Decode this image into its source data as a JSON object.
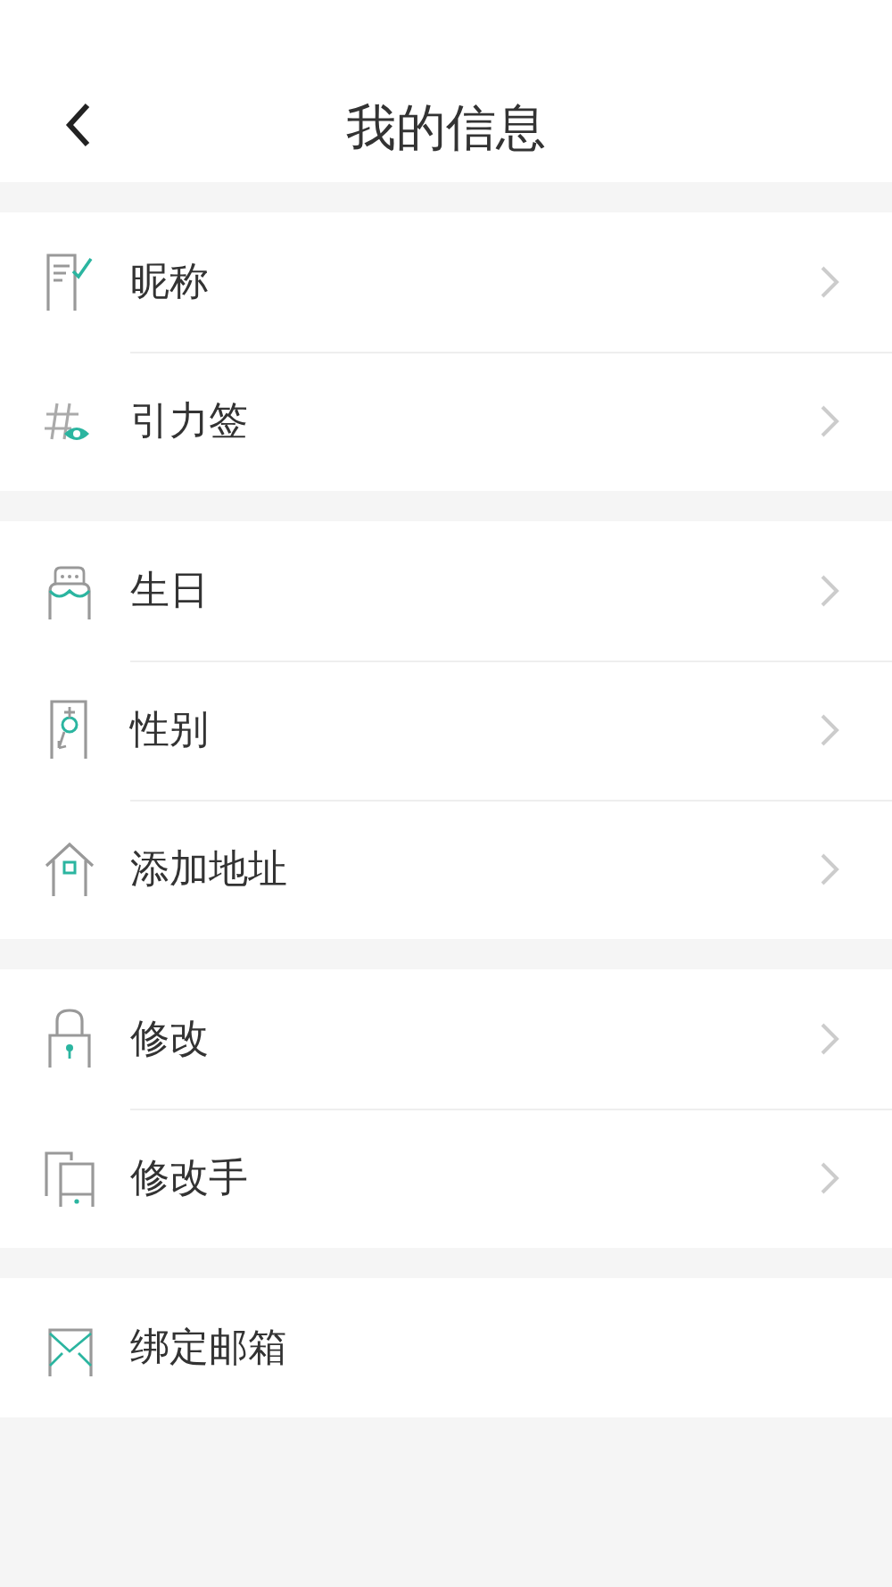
{
  "header": {
    "title": "我的信息"
  },
  "groups": [
    {
      "items": [
        {
          "kind": "nickname",
          "label": "昵称",
          "chevron": true
        },
        {
          "kind": "tag",
          "label": "引力签",
          "chevron": true
        }
      ]
    },
    {
      "items": [
        {
          "kind": "birthday",
          "label": "生日",
          "chevron": true
        },
        {
          "kind": "gender",
          "label": "性别",
          "chevron": true
        },
        {
          "kind": "address",
          "label": "添加地址",
          "chevron": true
        }
      ]
    },
    {
      "items": [
        {
          "kind": "password",
          "label": "修改",
          "chevron": true
        },
        {
          "kind": "phone",
          "label": "修改手",
          "chevron": true
        }
      ]
    },
    {
      "items": [
        {
          "kind": "email",
          "label": "绑定邮箱",
          "chevron": false
        }
      ]
    }
  ]
}
